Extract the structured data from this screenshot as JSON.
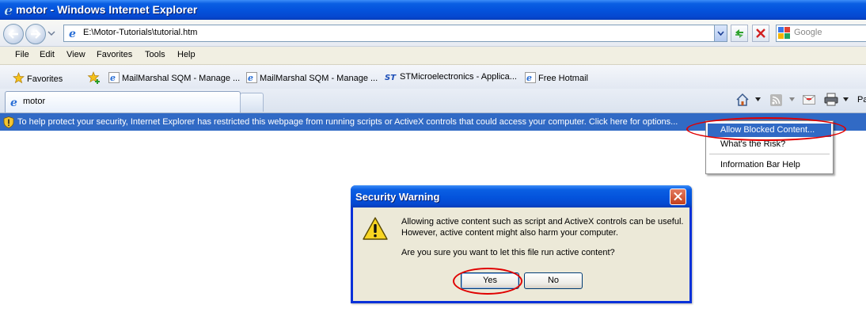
{
  "window": {
    "title": "motor - Windows Internet Explorer"
  },
  "address_bar": {
    "url": "E:\\Motor-Tutorials\\tutorial.htm"
  },
  "search": {
    "placeholder": "Google"
  },
  "menu": [
    "File",
    "Edit",
    "View",
    "Favorites",
    "Tools",
    "Help"
  ],
  "favorites_bar": {
    "favorites_label": "Favorites",
    "links": [
      "MailMarshal SQM - Manage ...",
      "MailMarshal SQM - Manage ...",
      "STMicroelectronics - Applica...",
      "Free Hotmail"
    ]
  },
  "tabs": [
    {
      "label": "motor"
    }
  ],
  "toolbar": {
    "page_label_partial": "Pa"
  },
  "info_bar": {
    "message": "To help protect your security, Internet Explorer has restricted this webpage from running scripts or ActiveX controls that could access your computer. Click here for options..."
  },
  "context_menu": {
    "items": [
      "Allow Blocked Content...",
      "What's the Risk?",
      "Information Bar Help"
    ],
    "selected_index": 0
  },
  "dialog": {
    "title": "Security Warning",
    "line1": "Allowing active content such as script and ActiveX controls can be useful.",
    "line2": "However, active content might also harm your computer.",
    "question": "Are you sure you want to let this file run active content?",
    "yes_label": "Yes",
    "no_label": "No"
  },
  "colors": {
    "titlebar_blue": "#0453dc",
    "info_bar_blue": "#316ac5",
    "dialog_bg": "#ece9d8",
    "highlight_red": "#e00000"
  }
}
